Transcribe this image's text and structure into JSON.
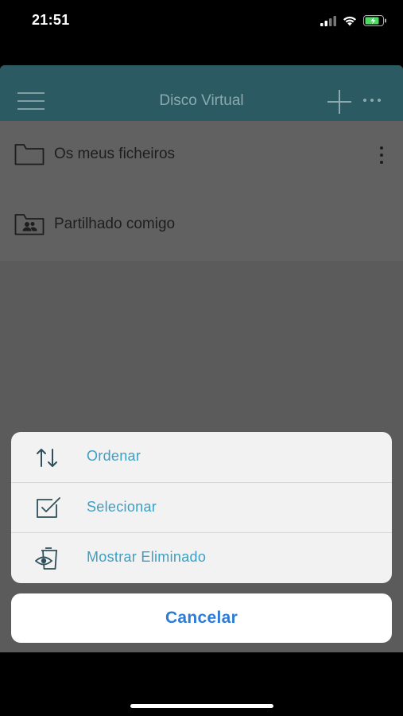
{
  "status_bar": {
    "time": "21:51",
    "icons": [
      "signal-icon",
      "wifi-icon",
      "battery-charging-icon"
    ]
  },
  "header": {
    "title": "Disco Virtual",
    "icons": [
      "menu-icon",
      "plus-icon",
      "more-icon"
    ]
  },
  "files": [
    {
      "label": "Os meus ficheiros",
      "icon": "folder-icon"
    },
    {
      "label": "Partilhado comigo",
      "icon": "shared-folder-icon"
    }
  ],
  "action_sheet": {
    "items": [
      {
        "label": "Ordenar",
        "icon": "sort-icon"
      },
      {
        "label": "Selecionar",
        "icon": "select-checkbox-icon"
      },
      {
        "label": "Mostrar Eliminado",
        "icon": "show-deleted-icon"
      }
    ],
    "cancel_label": "Cancelar"
  },
  "colors": {
    "header_bg": "#2b5a63",
    "action_text": "#3c9fc4",
    "cancel_text": "#2e7bd6"
  }
}
